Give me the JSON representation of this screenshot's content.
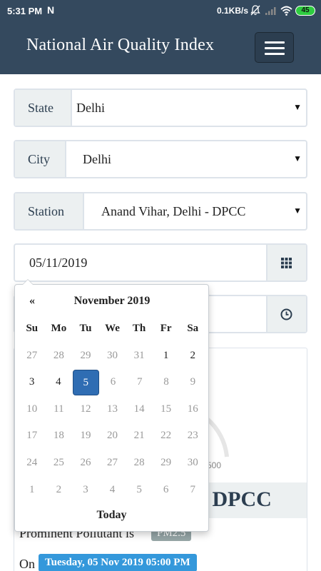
{
  "status_bar": {
    "time": "5:31 PM",
    "app_icon_letter": "N",
    "net_speed": "0.1KB/s",
    "battery": "45",
    "icons": [
      "mute-icon",
      "signal-icon",
      "wifi-icon",
      "battery-icon"
    ]
  },
  "navbar": {
    "title": "National Air Quality Index",
    "menu_icon": "hamburger-icon",
    "color": "#34495e"
  },
  "filters": {
    "state": {
      "label": "State",
      "value": "Delhi"
    },
    "city": {
      "label": "City",
      "value": "Delhi"
    },
    "station": {
      "label": "Station",
      "value": "Anand Vihar, Delhi - DPCC"
    },
    "date": {
      "value": "05/11/2019",
      "icon": "calendar-grid-icon"
    },
    "time": {
      "icon": "clock-icon"
    }
  },
  "datepicker": {
    "prev": "«",
    "month": "November 2019",
    "weekdays": [
      "Su",
      "Mo",
      "Tu",
      "We",
      "Th",
      "Fr",
      "Sa"
    ],
    "weeks": [
      [
        "27",
        "28",
        "29",
        "30",
        "31",
        "1",
        "2"
      ],
      [
        "3",
        "4",
        "5",
        "6",
        "7",
        "8",
        "9"
      ],
      [
        "10",
        "11",
        "12",
        "13",
        "14",
        "15",
        "16"
      ],
      [
        "17",
        "18",
        "19",
        "20",
        "21",
        "22",
        "23"
      ],
      [
        "24",
        "25",
        "26",
        "27",
        "28",
        "29",
        "30"
      ],
      [
        "1",
        "2",
        "3",
        "4",
        "5",
        "6",
        "7"
      ]
    ],
    "selected": "5",
    "today": "Today",
    "accent": "#2f6db3"
  },
  "result": {
    "gauge_max": "500",
    "station_heading": "- DPCC",
    "pollutant_text": "Prominent Pollutant is",
    "pollutant": "PM2.5",
    "on_text": "On",
    "timestamp": "Tuesday, 05 Nov 2019 05:00 PM",
    "timestamp_color": "#3498db"
  }
}
